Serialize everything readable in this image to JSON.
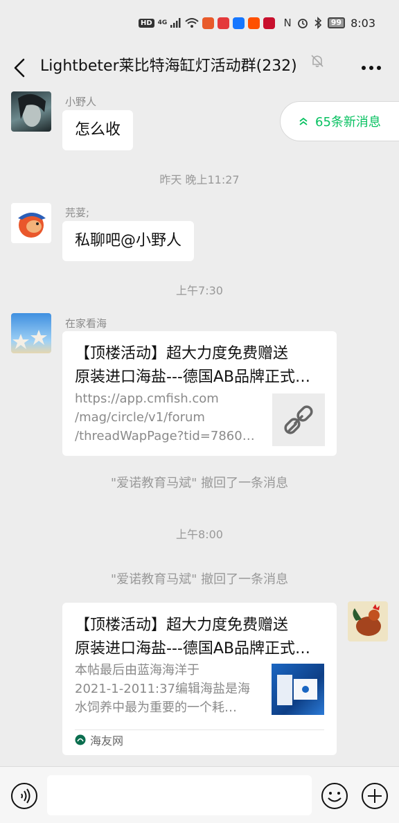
{
  "status_bar": {
    "hd": "HD",
    "network": "4G",
    "battery": "99",
    "time": "8:03"
  },
  "nav": {
    "title": "Lightbeter莱比特海缸灯活动群(232)",
    "back_icon": "chevron-left-icon",
    "mute_icon": "bell-off-icon",
    "more_icon": "more-dots-icon"
  },
  "new_messages": {
    "label": "65条新消息",
    "icon": "double-chevron-up-icon",
    "color": "#07c160"
  },
  "messages": [
    {
      "sender": "小野人",
      "text": "怎么收"
    },
    {
      "timestamp": "昨天 晚上11:27"
    },
    {
      "sender": "芫荽;",
      "text": "私聊吧@小野人"
    },
    {
      "timestamp": "上午7:30"
    },
    {
      "sender": "在家看海",
      "card": {
        "title_line1": "【顶楼活动】超大力度免费赠送",
        "title_line2": "原装进口海盐---德国AB品牌正式…",
        "desc_line1": "https://app.cmfish.com",
        "desc_line2": "/mag/circle/v1/forum",
        "desc_line3": "/threadWapPage?tid=78601…",
        "thumb_icon": "link-icon"
      }
    },
    {
      "system": "\"爱诺教育马斌\" 撤回了一条消息"
    },
    {
      "timestamp": "上午8:00"
    },
    {
      "system": "\"爱诺教育马斌\" 撤回了一条消息"
    },
    {
      "self": true,
      "card": {
        "title_line1": "【顶楼活动】超大力度免费赠送",
        "title_line2": "原装进口海盐---德国AB品牌正式…",
        "desc_line1": "本帖最后由蓝海海洋于",
        "desc_line2": "2021-1-2011:37编辑海盐是海",
        "desc_line3": "水饲养中最为重要的一个耗…",
        "source": "海友网",
        "source_icon": "haiyou-logo-icon"
      }
    }
  ],
  "input_bar": {
    "voice_icon": "voice-icon",
    "emoji_icon": "emoji-icon",
    "plus_icon": "plus-icon"
  },
  "colors": {
    "background": "#ededed",
    "bubble": "#ffffff",
    "accent": "#07c160"
  }
}
